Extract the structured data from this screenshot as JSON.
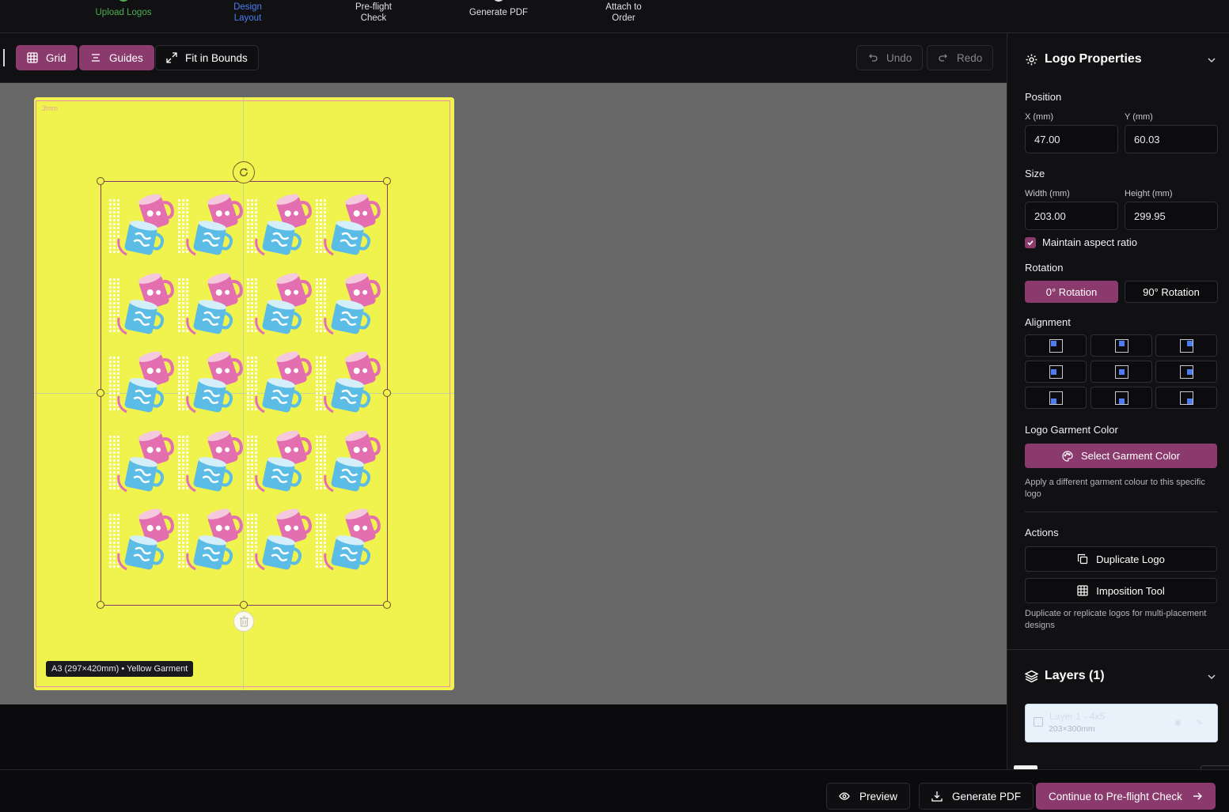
{
  "colors": {
    "accent": "#8b3a6e",
    "success": "#4caf50",
    "link": "#4d7df0",
    "garment": "#f0f24d",
    "canvas_bg": "#676767"
  },
  "steps": [
    {
      "label": "Upload Logos",
      "state": "complete",
      "color": "#4caf50"
    },
    {
      "label": "Design Layout",
      "state": "active",
      "color": "#4d7df0"
    },
    {
      "label": "Pre-flight Check",
      "state": "pending",
      "color": "#e0e0e4"
    },
    {
      "label": "Generate PDF",
      "state": "pending",
      "color": "#e0e0e4"
    },
    {
      "label": "Attach to Order",
      "state": "pending",
      "color": "#e0e0e4"
    }
  ],
  "toolbar": {
    "grid": "Grid",
    "guides": "Guides",
    "fit": "Fit in Bounds",
    "undo": "Undo",
    "redo": "Redo"
  },
  "canvas": {
    "bleed_label": "3mm",
    "artboard_badge": "A3 (297×420mm) • Yellow Garment"
  },
  "properties": {
    "title": "Logo Properties",
    "position": {
      "label": "Position",
      "x_label": "X (mm)",
      "x_value": "47.00",
      "y_label": "Y (mm)",
      "y_value": "60.03"
    },
    "size": {
      "label": "Size",
      "w_label": "Width (mm)",
      "w_value": "203.00",
      "h_label": "Height (mm)",
      "h_value": "299.95",
      "aspect_label": "Maintain aspect ratio",
      "aspect_checked": true
    },
    "rotation": {
      "label": "Rotation",
      "options": [
        "0° Rotation",
        "90° Rotation"
      ],
      "selected": "0° Rotation"
    },
    "alignment": {
      "label": "Alignment",
      "options": [
        "top-left",
        "top-center",
        "top-right",
        "middle-left",
        "middle-center",
        "middle-right",
        "bottom-left",
        "bottom-center",
        "bottom-right"
      ]
    },
    "garment_color": {
      "label": "Logo Garment Color",
      "button": "Select Garment Color",
      "help": "Apply a different garment colour to this specific logo"
    },
    "actions": {
      "label": "Actions",
      "duplicate": "Duplicate Logo",
      "imposition": "Imposition Tool",
      "help": "Duplicate or replicate logos for multi-placement designs"
    }
  },
  "layers": {
    "title": "Layers (1)",
    "items": [
      {
        "name": "Layer 1 - 4x5",
        "size": "203×300mm"
      }
    ]
  },
  "footer": {
    "preview": "Preview",
    "generate": "Generate PDF",
    "continue": "Continue to Pre-flight Check"
  }
}
